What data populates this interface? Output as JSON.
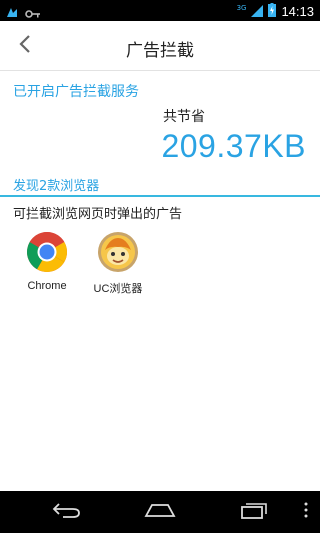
{
  "status_bar": {
    "network": "3G",
    "time": "14:13"
  },
  "header": {
    "title": "广告拦截"
  },
  "service": {
    "enabled_text": "已开启广告拦截服务",
    "saved_label": "共节省",
    "saved_amount": "209.37KB"
  },
  "browsers_section": {
    "found_text": "发现2款浏览器",
    "description": "可拦截浏览网页时弹出的广告",
    "items": [
      {
        "name": "Chrome",
        "icon": "chrome-icon"
      },
      {
        "name": "UC浏览器",
        "icon": "uc-browser-icon"
      }
    ]
  },
  "colors": {
    "accent": "#2aa3e3",
    "divider": "#38b8e0"
  }
}
